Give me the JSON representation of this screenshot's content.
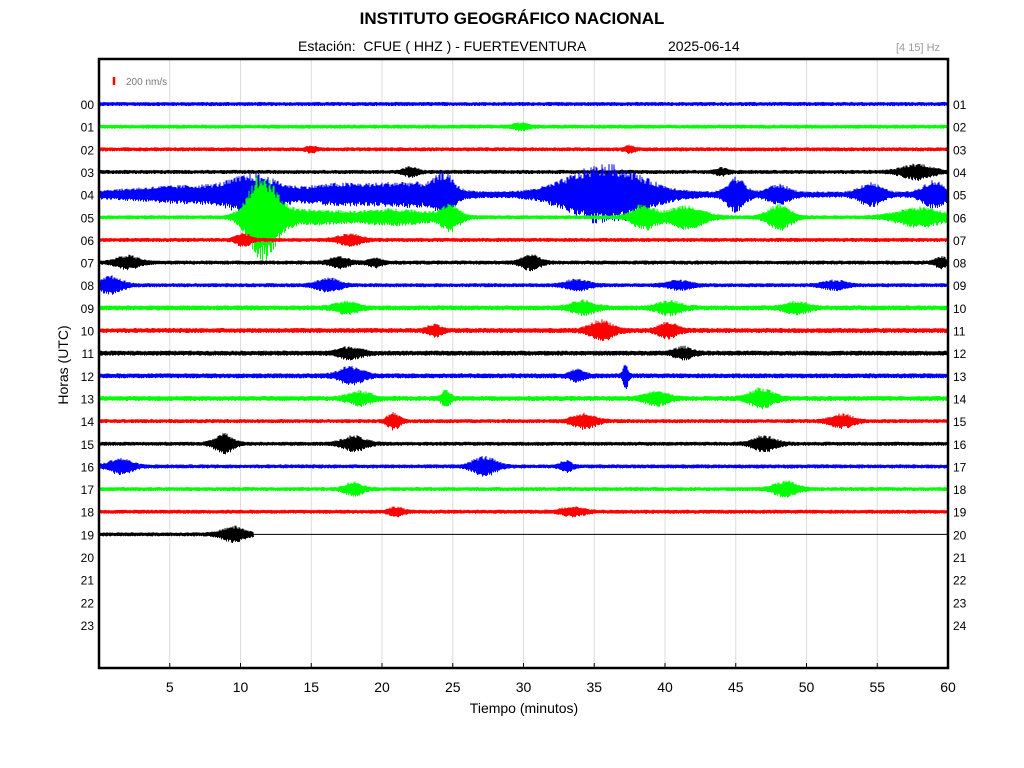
{
  "header": {
    "title": "INSTITUTO GEOGRÁFICO NACIONAL",
    "subtitle": "Estación:  CFUE ( HHZ ) - FUERTEVENTURA",
    "date": "2025-06-14",
    "band": "[4 15] Hz"
  },
  "scale": {
    "label": "200 nm/s",
    "color": "#ff0000"
  },
  "chart_data": {
    "type": "line",
    "xlabel": "Tiempo (minutos)",
    "ylabel": "Horas (UTC)",
    "xlim": [
      0,
      60
    ],
    "x_ticks": [
      5,
      10,
      15,
      20,
      25,
      30,
      35,
      40,
      45,
      50,
      55,
      60
    ],
    "grid": true,
    "color_cycle": [
      "#0000ff",
      "#00ff00",
      "#ff0000",
      "#000000"
    ],
    "left_labels": [
      "00",
      "01",
      "02",
      "03",
      "04",
      "05",
      "06",
      "07",
      "08",
      "09",
      "10",
      "11",
      "12",
      "13",
      "14",
      "15",
      "16",
      "17",
      "18",
      "19",
      "20",
      "21",
      "22",
      "23"
    ],
    "right_labels": [
      "01",
      "02",
      "03",
      "04",
      "05",
      "06",
      "07",
      "08",
      "09",
      "10",
      "11",
      "12",
      "13",
      "14",
      "15",
      "16",
      "17",
      "18",
      "19",
      "20",
      "21",
      "22",
      "23",
      "24"
    ],
    "traces": [
      {
        "hour": "00",
        "color": "#0000ff",
        "end": 60,
        "amp": 2,
        "events": []
      },
      {
        "hour": "01",
        "color": "#00ff00",
        "end": 60,
        "amp": 2,
        "events": [
          [
            29.8,
            0.6,
            3
          ]
        ]
      },
      {
        "hour": "02",
        "color": "#ff0000",
        "end": 60,
        "amp": 2,
        "events": [
          [
            15,
            0.4,
            3
          ],
          [
            37.5,
            0.4,
            3
          ]
        ]
      },
      {
        "hour": "03",
        "color": "#000000",
        "end": 60,
        "amp": 2,
        "events": [
          [
            22,
            0.6,
            4
          ],
          [
            44,
            0.5,
            3
          ],
          [
            57.8,
            1.3,
            7
          ]
        ]
      },
      {
        "hour": "04",
        "color": "#0000ff",
        "end": 60,
        "amp": 3,
        "events": [
          [
            7,
            6,
            7
          ],
          [
            11,
            2,
            14
          ],
          [
            17,
            3,
            8
          ],
          [
            22,
            3,
            10
          ],
          [
            24.4,
            0.8,
            16
          ],
          [
            35.8,
            3.5,
            28
          ],
          [
            45,
            0.8,
            16
          ],
          [
            48,
            1,
            8
          ],
          [
            54.5,
            1,
            10
          ],
          [
            59,
            1,
            12
          ]
        ]
      },
      {
        "hour": "05",
        "color": "#00ff00",
        "end": 60,
        "amp": 2,
        "events": [
          [
            11,
            1,
            16
          ],
          [
            11.8,
            1.3,
            30
          ],
          [
            15,
            3,
            6
          ],
          [
            21,
            3,
            7
          ],
          [
            24.8,
            0.8,
            12
          ],
          [
            38.5,
            1,
            12
          ],
          [
            41.5,
            1.5,
            11
          ],
          [
            48.1,
            1,
            12
          ],
          [
            58,
            2,
            9
          ]
        ]
      },
      {
        "hour": "06",
        "color": "#ff0000",
        "end": 60,
        "amp": 2,
        "events": [
          [
            10.2,
            0.6,
            6
          ],
          [
            17.7,
            1,
            5
          ]
        ]
      },
      {
        "hour": "07",
        "color": "#000000",
        "end": 60,
        "amp": 2,
        "events": [
          [
            2,
            1,
            6
          ],
          [
            17,
            0.8,
            5
          ],
          [
            19.5,
            0.6,
            4
          ],
          [
            30.5,
            0.8,
            7
          ],
          [
            59.5,
            0.5,
            5
          ]
        ]
      },
      {
        "hour": "08",
        "color": "#0000ff",
        "end": 60,
        "amp": 2,
        "events": [
          [
            0.8,
            1,
            8
          ],
          [
            16.2,
            1,
            6
          ],
          [
            33.8,
            1,
            5
          ],
          [
            41,
            1,
            4
          ],
          [
            52,
            1,
            4
          ]
        ]
      },
      {
        "hour": "09",
        "color": "#00ff00",
        "end": 60,
        "amp": 2.5,
        "events": [
          [
            17.5,
            1,
            5
          ],
          [
            34.2,
            1,
            6
          ],
          [
            40.3,
            1,
            6
          ],
          [
            49.3,
            1,
            5
          ]
        ]
      },
      {
        "hour": "10",
        "color": "#ff0000",
        "end": 60,
        "amp": 2.5,
        "events": [
          [
            23.7,
            0.6,
            5
          ],
          [
            35.5,
            1,
            9
          ],
          [
            40.2,
            0.8,
            7
          ]
        ]
      },
      {
        "hour": "11",
        "color": "#000000",
        "end": 60,
        "amp": 2.5,
        "events": [
          [
            17.7,
            1,
            5
          ],
          [
            41.3,
            0.8,
            5
          ]
        ]
      },
      {
        "hour": "12",
        "color": "#0000ff",
        "end": 60,
        "amp": 2.5,
        "events": [
          [
            17.8,
            1,
            8
          ],
          [
            33.8,
            0.6,
            5
          ],
          [
            37.2,
            0.2,
            14
          ]
        ]
      },
      {
        "hour": "13",
        "color": "#00ff00",
        "end": 60,
        "amp": 2.5,
        "events": [
          [
            18.4,
            1,
            6
          ],
          [
            24.5,
            0.4,
            7
          ],
          [
            39.4,
            1,
            6
          ],
          [
            46.8,
            1,
            9
          ]
        ]
      },
      {
        "hour": "14",
        "color": "#ff0000",
        "end": 60,
        "amp": 2,
        "events": [
          [
            20.8,
            0.5,
            8
          ],
          [
            34.3,
            1,
            7
          ],
          [
            52.5,
            1,
            6
          ]
        ]
      },
      {
        "hour": "15",
        "color": "#000000",
        "end": 60,
        "amp": 2,
        "events": [
          [
            8.8,
            0.8,
            9
          ],
          [
            18,
            1,
            7
          ],
          [
            47,
            1,
            7
          ]
        ]
      },
      {
        "hour": "16",
        "color": "#0000ff",
        "end": 60,
        "amp": 2,
        "events": [
          [
            1.5,
            1,
            7
          ],
          [
            27.2,
            1,
            9
          ],
          [
            33,
            0.5,
            5
          ]
        ]
      },
      {
        "hour": "17",
        "color": "#00ff00",
        "end": 60,
        "amp": 2,
        "events": [
          [
            18,
            0.8,
            6
          ],
          [
            48.5,
            1,
            7
          ]
        ]
      },
      {
        "hour": "18",
        "color": "#ff0000",
        "end": 60,
        "amp": 2,
        "events": [
          [
            21,
            0.6,
            4
          ],
          [
            33.5,
            1,
            4
          ]
        ]
      },
      {
        "hour": "19",
        "color": "#000000",
        "end": 10.9,
        "amp": 2,
        "events": [
          [
            9.5,
            1,
            7
          ]
        ]
      }
    ]
  }
}
